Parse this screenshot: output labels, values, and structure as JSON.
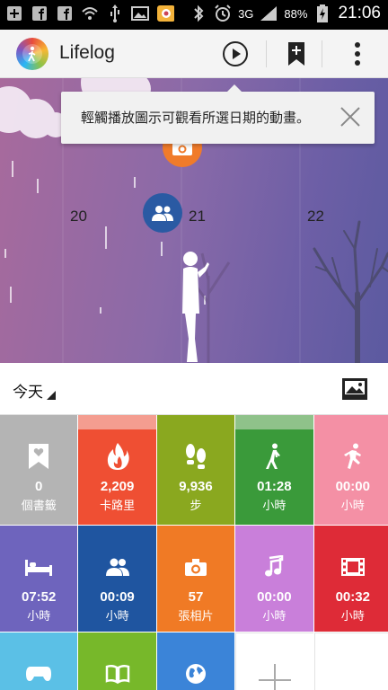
{
  "status_bar": {
    "battery_percent": "88%",
    "network": "3G",
    "time": "21:06",
    "icons": [
      "add-icon",
      "facebook-icon",
      "facebook-icon",
      "wifi-icon",
      "usb-icon",
      "image-icon",
      "app-notification-icon",
      "bluetooth-icon",
      "alarm-icon",
      "signal-icon",
      "battery-charging-icon"
    ]
  },
  "app_bar": {
    "title": "Lifelog",
    "actions": [
      "play-icon",
      "bookmark-add-icon",
      "overflow-menu-icon"
    ]
  },
  "timeline": {
    "tooltip": "輕觸播放圖示可觀看所選日期的動畫。",
    "days": [
      "20",
      "21",
      "22"
    ],
    "bubbles": [
      "camera-icon",
      "friends-icon"
    ]
  },
  "date_bar": {
    "label": "今天",
    "action_icon": "wallpaper-icon"
  },
  "tiles": [
    {
      "icon": "bookmark-heart-icon",
      "value": "0",
      "unit": "個書籤",
      "color": "#b4b4b4"
    },
    {
      "icon": "flame-icon",
      "value": "2,209",
      "unit": "卡路里",
      "color": "#ef4f33",
      "band": "#f49d90"
    },
    {
      "icon": "footsteps-icon",
      "value": "9,936",
      "unit": "步",
      "color": "#8aa81f"
    },
    {
      "icon": "walking-icon",
      "value": "01:28",
      "unit": "小時",
      "color": "#3a9a3a",
      "band": "#8fc28a"
    },
    {
      "icon": "running-icon",
      "value": "00:00",
      "unit": "小時",
      "color": "#f490a5"
    },
    {
      "icon": "bed-icon",
      "value": "07:52",
      "unit": "小時",
      "color": "#6e64bd"
    },
    {
      "icon": "friends-icon",
      "value": "00:09",
      "unit": "小時",
      "color": "#1f55a0"
    },
    {
      "icon": "camera-icon",
      "value": "57",
      "unit": "張相片",
      "color": "#f07a25"
    },
    {
      "icon": "music-note-icon",
      "value": "00:00",
      "unit": "小時",
      "color": "#c97fda"
    },
    {
      "icon": "film-icon",
      "value": "00:32",
      "unit": "小時",
      "color": "#de2b37"
    },
    {
      "icon": "gamepad-icon",
      "color": "#5bc0e6"
    },
    {
      "icon": "book-icon",
      "color": "#77b82a"
    },
    {
      "icon": "globe-icon",
      "color": "#3b84d8"
    },
    {
      "icon": "add-icon"
    }
  ]
}
